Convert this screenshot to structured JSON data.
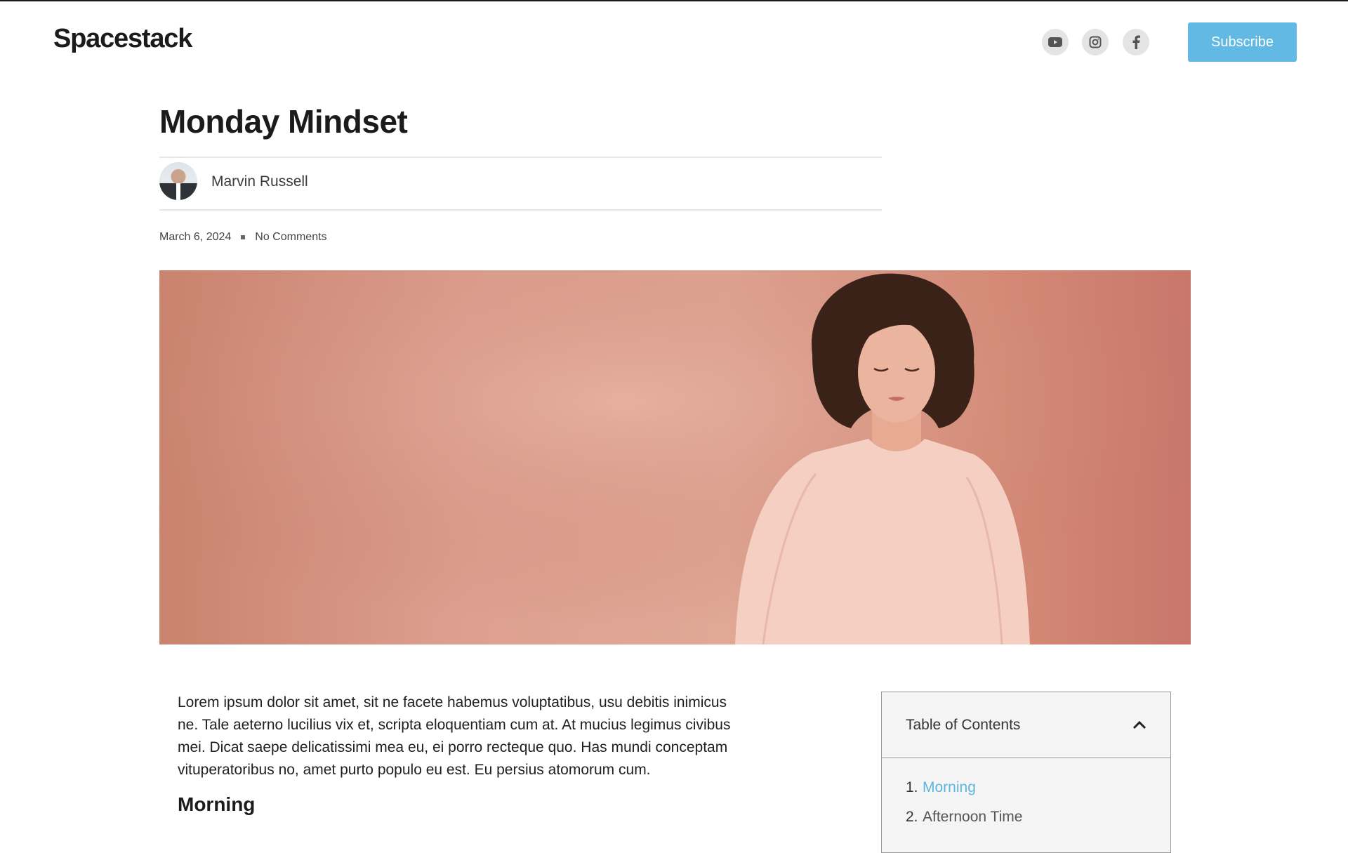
{
  "site": {
    "logo": "Spacestack",
    "subscribe_label": "Subscribe",
    "social_icons": [
      "youtube-icon",
      "instagram-icon",
      "facebook-icon"
    ],
    "accent_color": "#62b9e4"
  },
  "article": {
    "title": "Monday Mindset",
    "author": "Marvin Russell",
    "date": "March 6, 2024",
    "comments": "No Comments",
    "intro": "Lorem ipsum dolor sit amet, sit ne facete habemus voluptatibus, usu debitis inimicus ne. Tale aeterno lucilius vix et, scripta eloquentiam cum at. At mucius legimus civibus mei. Dicat saepe delicatissimi mea eu, ei porro recteque quo. Has mundi conceptam vituperatoribus no, amet purto populo eu est. Eu persius atomorum cum.",
    "section_heading": "Morning"
  },
  "toc": {
    "title": "Table of Contents",
    "items": [
      {
        "num": "1.",
        "label": "Morning"
      },
      {
        "num": "2.",
        "label": "Afternoon Time"
      }
    ]
  }
}
